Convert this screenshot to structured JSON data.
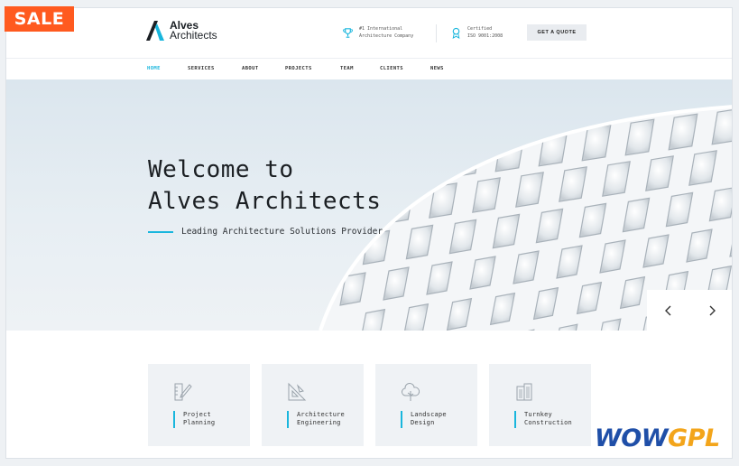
{
  "badge": {
    "sale": "SALE"
  },
  "header": {
    "logo_line1": "Alves",
    "logo_line2": "Architects",
    "info1_line1": "#1 International",
    "info1_line2": "Architecture Company",
    "info2_line1": "Certified",
    "info2_line2": "ISO 9001:2008",
    "quote_label": "GET A QUOTE"
  },
  "nav": {
    "items": [
      {
        "label": "HOME"
      },
      {
        "label": "SERVICES"
      },
      {
        "label": "ABOUT"
      },
      {
        "label": "PROJECTS"
      },
      {
        "label": "TEAM"
      },
      {
        "label": "CLIENTS"
      },
      {
        "label": "NEWS"
      }
    ]
  },
  "hero": {
    "title_line1": "Welcome to",
    "title_line2": "Alves Architects",
    "subtitle": "Leading Architecture Solutions Provider"
  },
  "services": [
    {
      "line1": "Project",
      "line2": "Planning",
      "icon": "pencil-ruler-icon"
    },
    {
      "line1": "Architecture",
      "line2": "Engineering",
      "icon": "set-square-icon"
    },
    {
      "line1": "Landscape",
      "line2": "Design",
      "icon": "tree-icon"
    },
    {
      "line1": "Turnkey",
      "line2": "Construction",
      "icon": "building-icon"
    }
  ],
  "watermark": {
    "part1": "WOW",
    "part2": "GPL"
  },
  "colors": {
    "accent": "#19b6dd",
    "sale": "#ff5a1f",
    "wow_blue": "#1f4fa8",
    "wow_orange": "#f3a51b"
  }
}
